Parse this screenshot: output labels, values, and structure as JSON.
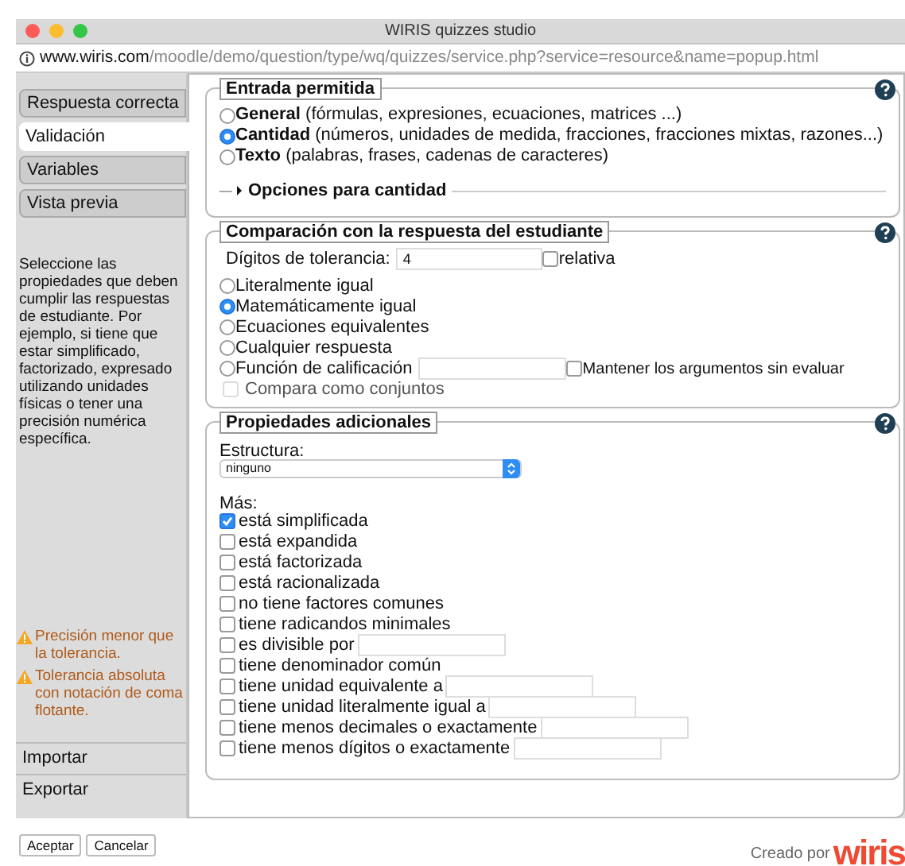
{
  "window": {
    "title": "WIRIS quizzes studio"
  },
  "url": {
    "host": "www.wiris.com",
    "path": "/moodle/demo/question/type/wq/quizzes/service.php?service=resource&name=popup.html"
  },
  "tabs": [
    {
      "label": "Respuesta correcta",
      "selected": false
    },
    {
      "label": "Validación",
      "selected": true
    },
    {
      "label": "Variables",
      "selected": false
    },
    {
      "label": "Vista previa",
      "selected": false
    }
  ],
  "help_text": "Seleccione las propiedades que deben cumplir las respuestas de estudiante. Por ejemplo, si tiene que estar simplificado, factorizado, expresado utilizando unidades físicas o tener una precisión numérica específica.",
  "warnings": [
    "Precisión menor que la tolerancia.",
    "Tolerancia absoluta con notación de coma flotante."
  ],
  "sidebar_bottom": [
    "Importar",
    "Exportar"
  ],
  "buttons": [
    "Aceptar",
    "Cancelar"
  ],
  "input_section": {
    "title": "Entrada permitida",
    "options": [
      {
        "label": "**General** (fórmulas, expresiones, ecuaciones, matrices ...)",
        "selected": false
      },
      {
        "label": "**Cantidad** (números, unidades de medida, fracciones, fracciones mixtas, razones...)",
        "selected": true
      },
      {
        "label": "**Texto** (palabras, frases, cadenas de caracteres)",
        "selected": false
      }
    ],
    "options_toggle": {
      "label": "Opciones para cantidad",
      "expanded": false
    }
  },
  "comparison_section": {
    "title": "Comparación con la respuesta del estudiante",
    "tolerance_label": "Dígitos de tolerancia:",
    "tolerance_value": "4",
    "relative": {
      "label": "relativa",
      "checked": false
    },
    "options": [
      {
        "kind": "plain",
        "label": "Literalmente igual",
        "selected": false
      },
      {
        "kind": "plain",
        "label": "Matemáticamente igual",
        "selected": true
      },
      {
        "kind": "plain",
        "label": "Ecuaciones equivalentes",
        "selected": false
      },
      {
        "kind": "plain",
        "label": "Cualquier respuesta",
        "selected": false
      },
      {
        "kind": "function",
        "label": "Función de calificación",
        "selected": false,
        "extra": {
          "label": "Mantener los argumentos sin evaluar",
          "checked": false
        }
      }
    ],
    "sets": {
      "label": "Compara como conjuntos",
      "checked": false,
      "disabled": true
    }
  },
  "properties_section": {
    "title": "Propiedades adicionales",
    "structure_label": "Estructura:",
    "structure_value": "ninguno",
    "more_label": "Más:",
    "items": [
      {
        "kind": "plain",
        "label": "está simplificada",
        "checked": true
      },
      {
        "kind": "plain",
        "label": "está expandida",
        "checked": false
      },
      {
        "kind": "plain",
        "label": "está factorizada",
        "checked": false
      },
      {
        "kind": "plain",
        "label": "está racionalizada",
        "checked": false
      },
      {
        "kind": "plain",
        "label": "no tiene factores comunes",
        "checked": false
      },
      {
        "kind": "plain",
        "label": "tiene radicandos minimales",
        "checked": false
      },
      {
        "kind": "field",
        "label": "es divisible por",
        "checked": false
      },
      {
        "kind": "plain",
        "label": "tiene denominador común",
        "checked": false
      },
      {
        "kind": "field",
        "label": "tiene unidad equivalente a",
        "checked": false
      },
      {
        "kind": "field",
        "label": "tiene unidad literalmente igual a",
        "checked": false
      },
      {
        "kind": "field",
        "label": "tiene menos decimales o exactamente",
        "checked": false
      },
      {
        "kind": "field",
        "label": "tiene menos dígitos o exactamente",
        "checked": false
      }
    ]
  },
  "footer": {
    "credit": "Creado por",
    "logo": "wiris"
  }
}
